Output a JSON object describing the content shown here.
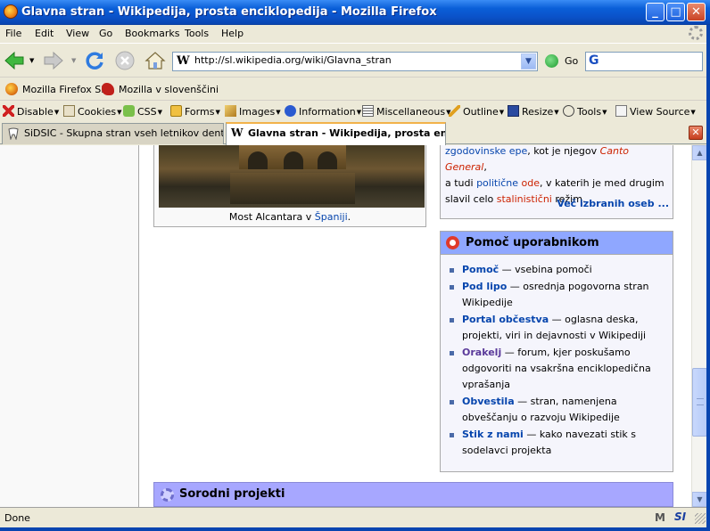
{
  "window": {
    "title": "Glavna stran - Wikipedija, prosta enciklopedija - Mozilla Firefox",
    "min": "_",
    "max": "□",
    "close": "✕"
  },
  "menu": [
    "File",
    "Edit",
    "View",
    "Go",
    "Bookmarks",
    "Tools",
    "Help"
  ],
  "nav": {
    "url": "http://sl.wikipedia.org/wiki/Glavna_stran",
    "url_icon": "W",
    "go_label": "Go",
    "search_value": ""
  },
  "bookmarks": [
    {
      "label": "Mozilla Firefox SI",
      "icon": "firefox-icon"
    },
    {
      "label": "Mozilla v slovenščini",
      "icon": "mozilla-icon"
    }
  ],
  "devbar": [
    {
      "label": "Disable",
      "icon": "disable-icon"
    },
    {
      "label": "Cookies",
      "icon": "cookies-icon"
    },
    {
      "label": "CSS",
      "icon": "css-icon"
    },
    {
      "label": "Forms",
      "icon": "forms-icon"
    },
    {
      "label": "Images",
      "icon": "images-icon"
    },
    {
      "label": "Information",
      "icon": "information-icon"
    },
    {
      "label": "Miscellaneous",
      "icon": "miscellaneous-icon"
    },
    {
      "label": "Outline",
      "icon": "outline-icon"
    },
    {
      "label": "Resize",
      "icon": "resize-icon"
    },
    {
      "label": "Tools",
      "icon": "tools-icon"
    },
    {
      "label": "View Source",
      "icon": "view-source-icon"
    }
  ],
  "tabs": [
    {
      "label": "SiDSIC - Skupna stran vseh letnikov dentaln...",
      "active": false
    },
    {
      "label": "Glavna stran - Wikipedija, prosta enc...",
      "active": true
    }
  ],
  "picture": {
    "caption_text": "Most Alcantara v ",
    "caption_link": "Španiji",
    "caption_end": "."
  },
  "person": {
    "l1_link1": "zgodovinske epe",
    "l1_text": ", kot je njegov ",
    "l1_red": "Canto General",
    "l1_end": ",",
    "l2_text1": "a tudi ",
    "l2_link": "politične",
    "l2_red": "ode",
    "l2_text2": ", v katerih je med drugim",
    "l3_text1": "slavil celo ",
    "l3_red": "stalinistični",
    "l3_text2": " režim.",
    "more": "Več izbranih oseb ..."
  },
  "help": {
    "title": "Pomoč uporabnikom",
    "items": [
      {
        "term": "Pomoč",
        "desc": " — vsebina pomoči"
      },
      {
        "term": "Pod lipo",
        "desc": " — osrednja pogovorna stran Wikipedije"
      },
      {
        "term": "Portal občestva",
        "desc": " — oglasna deska, projekti, viri in dejavnosti v Wikipediji"
      },
      {
        "term": "Orakelj",
        "desc": " — forum, kjer poskušamo odgovoriti na vsakršna enciklopedična vprašanja"
      },
      {
        "term": "Obvestila",
        "desc": " — stran, namenjena obveščanju o razvoju Wikipedije"
      },
      {
        "term": "Stik z nami",
        "desc": " — kako navezati stik s sodelavci projekta"
      }
    ]
  },
  "related": {
    "title": "Sorodni projekti"
  },
  "status": {
    "text": "Done",
    "m_icon": "M",
    "si_icon": "SI"
  }
}
